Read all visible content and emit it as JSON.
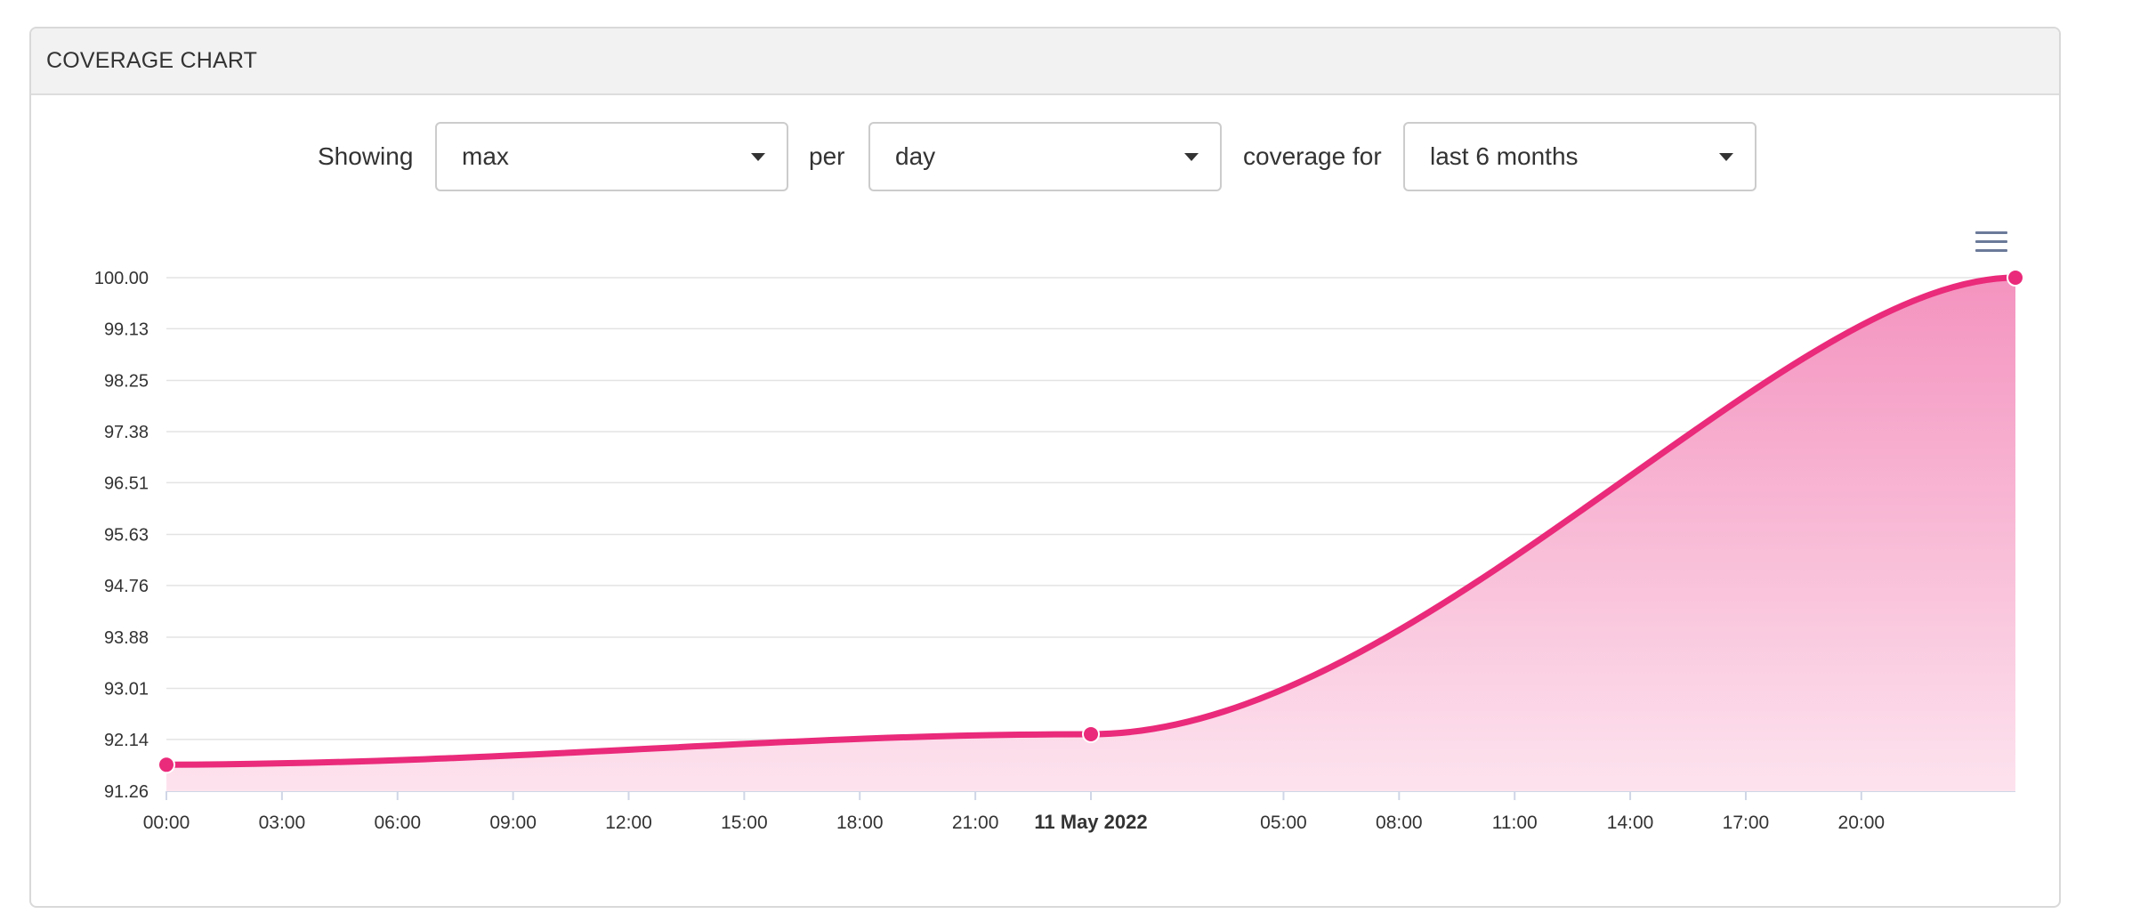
{
  "panel": {
    "title": "COVERAGE CHART"
  },
  "controls": {
    "showing_label": "Showing",
    "metric_value": "max",
    "per_label": "per",
    "period_value": "day",
    "coverage_for_label": "coverage for",
    "range_value": "last 6 months"
  },
  "menu": {
    "icon": "hamburger-menu-icon"
  },
  "colors": {
    "line": "#ea2a7a",
    "area_top": "#f493bf",
    "area_bottom": "#fde3ee",
    "grid": "#e3e3e3",
    "axis_text": "#333333"
  },
  "chart_data": {
    "type": "area",
    "title": "",
    "xlabel": "",
    "ylabel": "",
    "x": [
      "2022-05-10 00:00",
      "2022-05-11 00:00",
      "2022-05-12 00:00"
    ],
    "series": [
      {
        "values": [
          91.71,
          92.23,
          100.0
        ]
      }
    ],
    "ylim": [
      91.26,
      100.0
    ],
    "y_ticks": [
      "91.26",
      "92.14",
      "93.01",
      "93.88",
      "94.76",
      "95.63",
      "96.51",
      "97.38",
      "98.25",
      "99.13",
      "100.00"
    ],
    "x_ticks": [
      {
        "t": "2022-05-10 00:00",
        "label": "00:00",
        "bold": false
      },
      {
        "t": "2022-05-10 03:00",
        "label": "03:00",
        "bold": false
      },
      {
        "t": "2022-05-10 06:00",
        "label": "06:00",
        "bold": false
      },
      {
        "t": "2022-05-10 09:00",
        "label": "09:00",
        "bold": false
      },
      {
        "t": "2022-05-10 12:00",
        "label": "12:00",
        "bold": false
      },
      {
        "t": "2022-05-10 15:00",
        "label": "15:00",
        "bold": false
      },
      {
        "t": "2022-05-10 18:00",
        "label": "18:00",
        "bold": false
      },
      {
        "t": "2022-05-10 21:00",
        "label": "21:00",
        "bold": false
      },
      {
        "t": "2022-05-11 00:00",
        "label": "11 May 2022",
        "bold": true
      },
      {
        "t": "2022-05-11 05:00",
        "label": "05:00",
        "bold": false
      },
      {
        "t": "2022-05-11 08:00",
        "label": "08:00",
        "bold": false
      },
      {
        "t": "2022-05-11 11:00",
        "label": "11:00",
        "bold": false
      },
      {
        "t": "2022-05-11 14:00",
        "label": "14:00",
        "bold": false
      },
      {
        "t": "2022-05-11 17:00",
        "label": "17:00",
        "bold": false
      },
      {
        "t": "2022-05-11 20:00",
        "label": "20:00",
        "bold": false
      }
    ],
    "xlim": [
      "2022-05-10 00:00",
      "2022-05-12 00:00"
    ],
    "grid": true,
    "legend": "none",
    "markers": true
  }
}
